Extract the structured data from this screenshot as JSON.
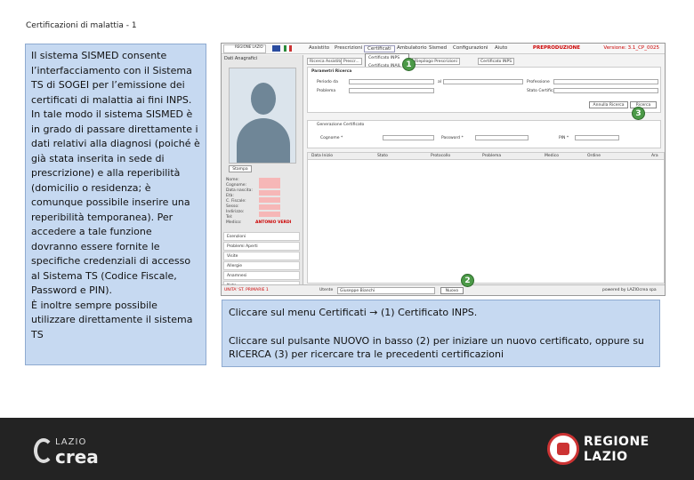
{
  "slide": {
    "title": "Certificazioni di malattia - 1"
  },
  "left_text": {
    "p1": "Il sistema SISMED consente l’interfacciamento con il Sistema TS di SOGEI per l’emissione dei certificati di malattia ai fini INPS.",
    "p2": "In tale modo il sistema SISMED è in grado di passare direttamente i dati relativi alla diagnosi (poiché è già stata inserita in sede di prescrizione) e alla reperibilità (domicilio o residenza; è comunque possibile inserire una reperibilità temporanea). Per accedere a tale funzione dovranno essere fornite le specifiche credenziali di accesso al Sistema TS (Codice Fiscale, Password e PIN).",
    "p3": "È inoltre sempre possibile utilizzare direttamente il sistema TS"
  },
  "app": {
    "logo_text": "REGIONE LAZIO",
    "menu": [
      "Assistito",
      "Prescrizioni",
      "Certificati",
      "Ambulatorio",
      "Sismed",
      "Configurazioni",
      "Aiuto"
    ],
    "environment_label": "PREPRODUZIONE",
    "version": "Versione: 3.1_CP_0025",
    "certificati_dropdown": [
      "Certificato INPS",
      "Certificato INAIL"
    ],
    "sidebar_tab": "Dati Anagrafici",
    "stampa_button": "Stampa",
    "patient_fields": [
      "Nome:",
      "Cognome:",
      "Data nascita:",
      "Età:",
      "C. Fiscale:",
      "Sesso:",
      "Indirizzo:",
      "Tel:",
      "Medico:"
    ],
    "patient_name": "ANTONIO VERDI",
    "side_items": [
      "Esenzioni",
      "Problemi Aperti",
      "Visite",
      "Allergie",
      "Anamnesi",
      "Note"
    ],
    "tabs": [
      "Ricerca Assistito",
      "Prescr...",
      "Riepilogo Prescrizioni",
      "Certificato INPS"
    ],
    "search_panel_title": "Parametri Ricerca",
    "search_labels": {
      "periodo": "Periodo da",
      "al": "al",
      "problema": "Problema",
      "professione": "Professione",
      "stato": "Stato Certificato"
    },
    "annulla_button": "Annulla Ricerca",
    "ricerca_button": "Ricerca",
    "section2_title": "Generazione Certificato",
    "section2_labels": {
      "cognome": "Cognome *",
      "password": "Password *",
      "pin": "PIN *"
    },
    "grid_headers": [
      "Data Inizio",
      "Stato",
      "Protocollo",
      "Problema",
      "Medico",
      "Ordine",
      "Ara"
    ],
    "bottom_status": "UNITA' ST. PRIMARIE 1",
    "bottom_user_label": "Utente",
    "bottom_user": "Giuseppe Bianchi",
    "bottom_new_button": "Nuovo",
    "bottom_powered": "powered by LAZIOcrea spa"
  },
  "markers": [
    "1",
    "2",
    "3"
  ],
  "right_text": {
    "line1": "Cliccare sul menu Certificati → (1) Certificato INPS.",
    "line2": "Cliccare sul pulsante NUOVO in basso (2) per iniziare un nuovo certificato, oppure su RICERCA (3) per ricercare tra le precedenti certificazioni"
  },
  "footer": {
    "lazio_small": "LAZIO",
    "lazio_big": "crea",
    "regione_line1": "REGIONE",
    "regione_line2": "LAZIO"
  }
}
